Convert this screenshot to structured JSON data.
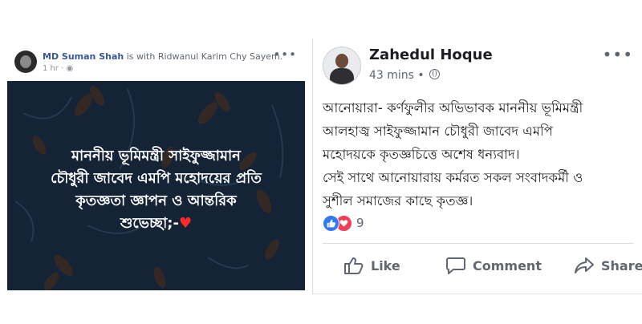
{
  "left_post": {
    "author": "MD Suman Shah",
    "with_text": "is with",
    "tagged": "Ridwanul Karim Chy Sayem.",
    "time": "1 hr",
    "more": "•••",
    "image_text": {
      "line1": "মাননীয় ভূমিমন্ত্রী সাইফুজ্জামান",
      "line2": "চৌধুরী জাবেদ এমপি মহোদয়ের প্রতি",
      "line3": "কৃতজ্ঞতা জ্ঞাপন ও আন্তরিক",
      "line4": "শুভেচ্ছা;-",
      "heart": "♥"
    }
  },
  "right_post": {
    "author": "Zahedul Hoque",
    "time": "43 mins",
    "more": "•••",
    "body": [
      "আনোয়ারা- কর্ণফুলীর অভিভাবক মাননীয় ভূমিমন্ত্রী",
      "আলহাজ্ব সাইফুজ্জামান চৌধুরী জাবেদ এমপি",
      "মহোদয়কে কৃতজ্ঞচিত্তে অশেষ ধন্যবাদ।",
      "সেই সাথে আনোয়ারায় কর্মরত সকল সংবাদকর্মী ও",
      "সুশীল সমাজের কাছে কৃতজ্ঞ।"
    ],
    "reaction_count": "9",
    "actions": {
      "like": "Like",
      "comment": "Comment",
      "share": "Share"
    }
  },
  "colors": {
    "name_link": "#385898",
    "image_bg": "#152336",
    "like_blue": "#2f7bf6",
    "love_red": "#f33e58"
  }
}
